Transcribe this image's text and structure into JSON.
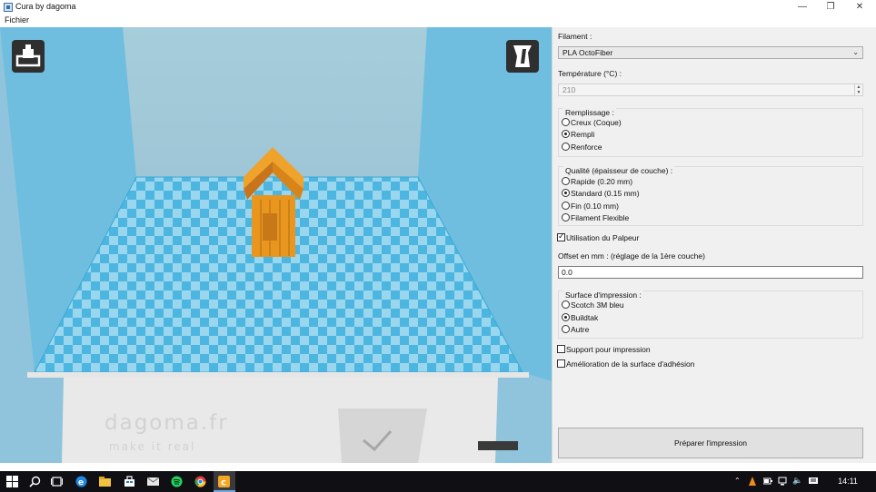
{
  "window": {
    "title": "Cura by dagoma",
    "controls": [
      "minimize-icon",
      "restore-icon",
      "close-icon"
    ]
  },
  "menu": {
    "file_label": "Fichier"
  },
  "viewport": {
    "printer_text_main": "dagoma.fr",
    "printer_text_sub": "make it real",
    "model_color": "#e8961e",
    "plate_light": "#9ad6ee",
    "plate_dark": "#4cb6e0",
    "left_button_icon": "load-model-icon",
    "right_button_icon": "view-mode-icon"
  },
  "panel": {
    "filament_label": "Filament :",
    "filament_value": "PLA OctoFiber",
    "temperature_label": "Température (°C) :",
    "temperature_value": "210",
    "infill": {
      "title": "Remplissage :",
      "options": [
        {
          "label": "Creux (Coque)",
          "selected": false
        },
        {
          "label": "Rempli",
          "selected": true
        },
        {
          "label": "Renforce",
          "selected": false
        }
      ]
    },
    "quality": {
      "title": "Qualité (épaisseur de couche) :",
      "options": [
        {
          "label": "Rapide (0.20 mm)",
          "selected": false
        },
        {
          "label": "Standard (0.15 mm)",
          "selected": true
        },
        {
          "label": "Fin (0.10 mm)",
          "selected": false
        },
        {
          "label": "Filament Flexible",
          "selected": false
        }
      ]
    },
    "probe_label": "Utilisation du Palpeur",
    "probe_checked": true,
    "offset_label": "Offset en mm : (réglage de la 1ère couche)",
    "offset_value": "0.0",
    "surface": {
      "title": "Surface d'impression :",
      "options": [
        {
          "label": "Scotch 3M bleu",
          "selected": false
        },
        {
          "label": "Buildtak",
          "selected": true
        },
        {
          "label": "Autre",
          "selected": false
        }
      ]
    },
    "support_label": "Support pour impression",
    "support_checked": false,
    "adhesion_label": "Amélioration de la surface d'adhésion",
    "adhesion_checked": false,
    "prepare_button": "Préparer l'impression"
  },
  "taskbar": {
    "clock": "14:11",
    "apps": [
      "windows-start-icon",
      "search-icon",
      "task-view-icon",
      "edge-icon",
      "file-explorer-icon",
      "store-icon",
      "mail-icon",
      "spotify-icon",
      "chrome-icon",
      "cura-icon"
    ],
    "tray": [
      "chevron-up-icon",
      "vlc-icon",
      "battery-icon",
      "network-icon",
      "volume-mute-icon",
      "notification-icon"
    ]
  }
}
